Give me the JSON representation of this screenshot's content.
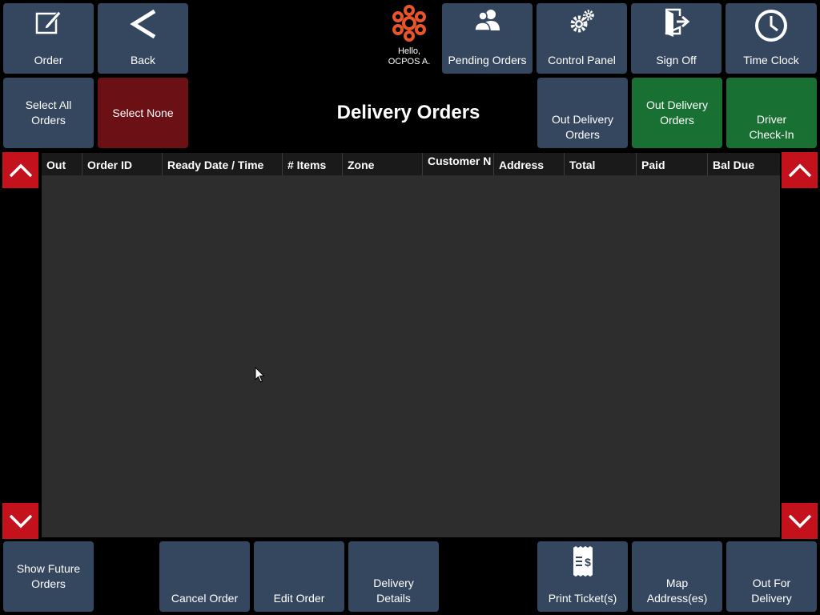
{
  "toolbar": {
    "order": "Order",
    "back": "Back",
    "pending_orders": "Pending Orders",
    "control_panel": "Control Panel",
    "sign_off": "Sign Off",
    "time_clock": "Time Clock"
  },
  "user": {
    "greeting": "Hello,",
    "name": "OCPOS A."
  },
  "selection": {
    "select_all": "Select All Orders",
    "select_none": "Select None"
  },
  "page_title": "Delivery Orders",
  "filters": {
    "out_delivery_orders_blue": "Out Delivery Orders",
    "out_delivery_orders_green": "Out Delivery Orders",
    "driver_checkin": "Driver Check-In"
  },
  "table": {
    "columns": [
      "Out",
      "Order ID",
      "Ready Date / Time",
      "# Items",
      "Zone",
      "Customer N",
      "Address",
      "Total",
      "Paid",
      "Bal Due"
    ],
    "rows": []
  },
  "footer": {
    "show_future_orders": "Show Future Orders",
    "cancel_order": "Cancel Order",
    "edit_order": "Edit Order",
    "delivery_details": "Delivery Details",
    "print_tickets": "Print Ticket(s)",
    "map_addresses": "Map Address(es)",
    "out_for_delivery": "Out For Delivery"
  },
  "colors": {
    "button": "#34475f",
    "select_none": "#6b1015",
    "green": "#197033",
    "scroll_arrow": "#c4121d",
    "grid": "#2d2d2d",
    "logo": "#e8552c"
  }
}
